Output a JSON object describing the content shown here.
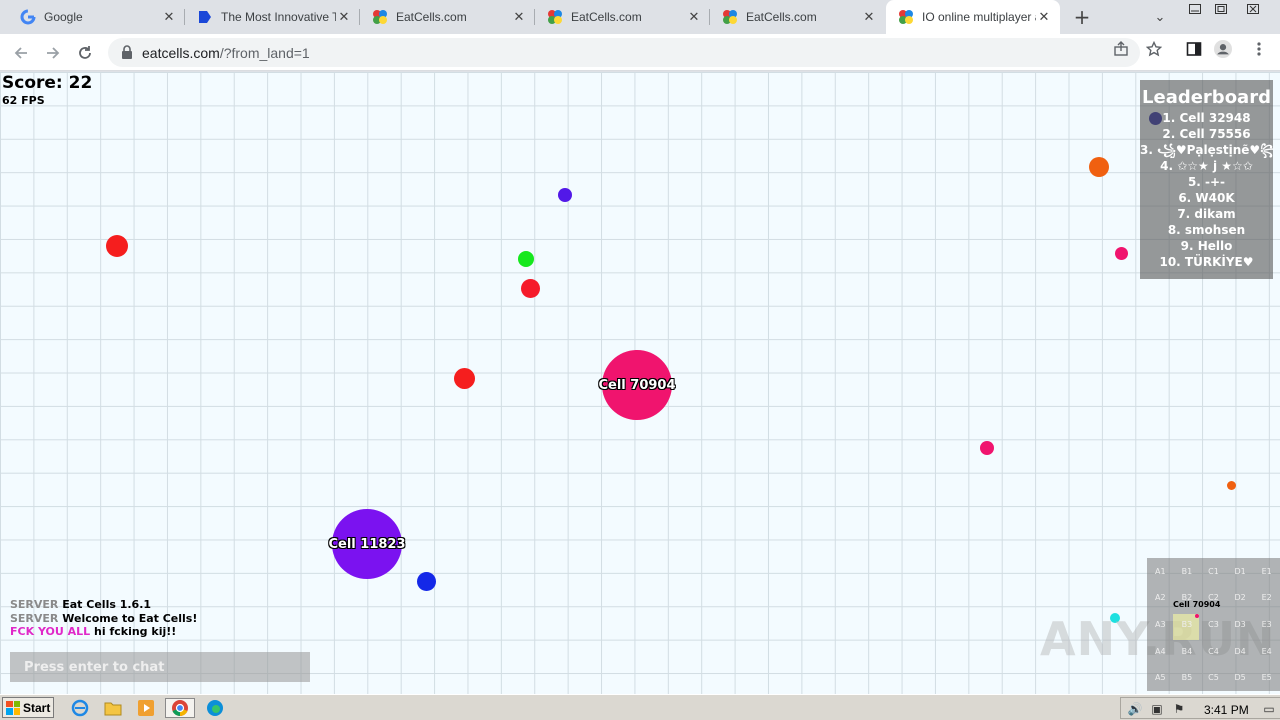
{
  "browser": {
    "tabs": [
      {
        "title": "Google",
        "favicon": "google-icon",
        "active": false
      },
      {
        "title": "The Most Innovative Tr",
        "favicon": "site-icon",
        "active": false
      },
      {
        "title": "EatCells.com",
        "favicon": "eatcells-icon",
        "active": false
      },
      {
        "title": "EatCells.com",
        "favicon": "eatcells-icon",
        "active": false
      },
      {
        "title": "EatCells.com",
        "favicon": "eatcells-icon",
        "active": false
      },
      {
        "title": "IO online multiplayer a",
        "favicon": "eatcells-icon",
        "active": true
      }
    ],
    "new_tab_glyph": "+",
    "url_host": "eatcells.com",
    "url_rest": "/?from_land=1"
  },
  "game": {
    "score_label": "Score: 22",
    "fps_label": "62 FPS",
    "cells": [
      {
        "name": "Cell 70904",
        "color": "#f0146e"
      },
      {
        "name": "Cell 11823",
        "color": "#7b12f0"
      }
    ],
    "pellet_colors": [
      "#f51e1e",
      "#16e81e",
      "#f51a2a",
      "#5218e8",
      "#f51e1e",
      "#1428e8",
      "#f06010",
      "#f0146e",
      "#f0146e",
      "#f06010",
      "#1a1aa0",
      "#1de0e0"
    ],
    "leaderboard": {
      "title": "Leaderboard",
      "entries": [
        "1. Cell 32948",
        "2. Cell 75556",
        "3. ꧁♥Pạlẹstịnẽ♥꧂",
        "4. ✩☆★ j ★☆✩",
        "5. -+-",
        "6. W40K",
        "7. dikam",
        "8. smohsen",
        "9. Hello",
        "10. TÜRKİYE♥"
      ]
    },
    "chat": {
      "messages": [
        {
          "sender": "SERVER",
          "text": "Eat Cells 1.6.1",
          "sender_color": "#8a8a8a"
        },
        {
          "sender": "SERVER",
          "text": "Welcome to Eat Cells!",
          "sender_color": "#8a8a8a"
        },
        {
          "sender": "FCK YOU ALL",
          "text": "hi fcking kij!!",
          "sender_color": "#e028c8"
        }
      ],
      "placeholder": "Press enter to chat"
    },
    "minimap": {
      "grid": [
        [
          "A1",
          "B1",
          "C1",
          "D1",
          "E1"
        ],
        [
          "A2",
          "B2",
          "C2",
          "D2",
          "E2"
        ],
        [
          "A3",
          "B3",
          "C3",
          "D3",
          "E3"
        ],
        [
          "A4",
          "B4",
          "C4",
          "D4",
          "E4"
        ],
        [
          "A5",
          "B5",
          "C5",
          "D5",
          "E5"
        ]
      ],
      "player_label": "Cell 70904"
    },
    "watermark": "ANY.RUN"
  },
  "taskbar": {
    "start_label": "Start",
    "clock": "3:41 PM"
  }
}
